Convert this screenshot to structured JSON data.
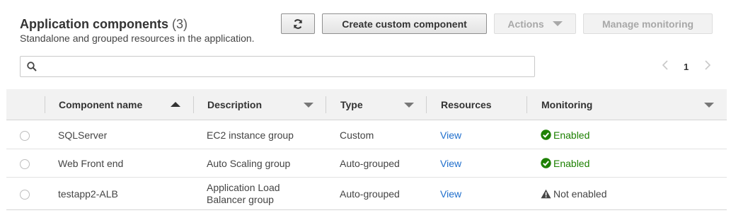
{
  "header": {
    "title": "Application components",
    "count": "(3)",
    "subtitle": "Standalone and grouped resources in the application."
  },
  "toolbar": {
    "refresh_icon": "refresh-icon",
    "create_label": "Create custom component",
    "actions_label": "Actions",
    "manage_label": "Manage monitoring"
  },
  "search": {
    "placeholder": "",
    "value": ""
  },
  "pagination": {
    "current_page": "1"
  },
  "table": {
    "columns": [
      {
        "label": "Component name",
        "sort": "ascending"
      },
      {
        "label": "Description"
      },
      {
        "label": "Type"
      },
      {
        "label": "Resources"
      },
      {
        "label": "Monitoring"
      }
    ],
    "rows": [
      {
        "name": "SQLServer",
        "description": "EC2 instance group",
        "type": "Custom",
        "resources": "View",
        "monitoring": "Enabled",
        "monitoring_status": "ok"
      },
      {
        "name": "Web Front end",
        "description": "Auto Scaling group",
        "type": "Auto-grouped",
        "resources": "View",
        "monitoring": "Enabled",
        "monitoring_status": "ok"
      },
      {
        "name": "testapp2-ALB",
        "description_line1": "Application Load",
        "description_line2": "Balancer group",
        "type": "Auto-grouped",
        "resources": "View",
        "monitoring": "Not enabled",
        "monitoring_status": "warning"
      }
    ]
  },
  "colors": {
    "enabled": "#1d8102",
    "link": "#1e6ecc",
    "header_bg": "#f2f2f2"
  }
}
